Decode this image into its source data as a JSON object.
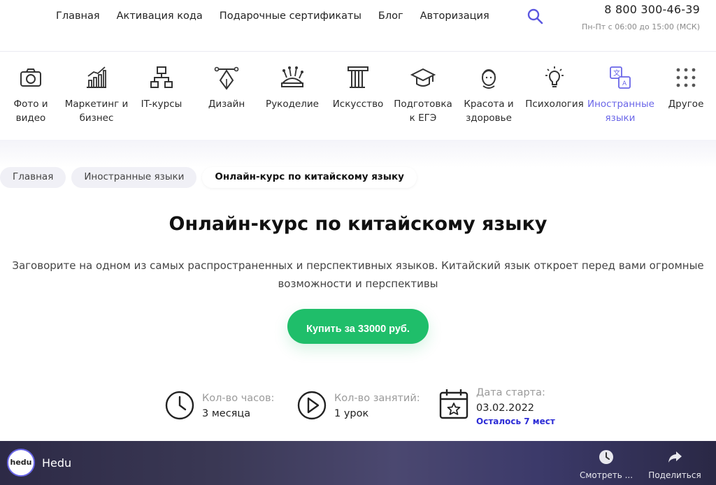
{
  "header": {
    "nav": [
      "Главная",
      "Активация кода",
      "Подарочные сертификаты",
      "Блог",
      "Авторизация"
    ],
    "phone": "8 800 300-46-39",
    "hours": "Пн-Пт с 06:00 до 15:00 (МСК)"
  },
  "categories": [
    {
      "label": "Фото и видео",
      "icon": "camera-icon"
    },
    {
      "label": "Маркетинг и бизнес",
      "icon": "chart-icon"
    },
    {
      "label": "IT-курсы",
      "icon": "network-icon"
    },
    {
      "label": "Дизайн",
      "icon": "pen-tool-icon"
    },
    {
      "label": "Рукоделие",
      "icon": "pincushion-icon"
    },
    {
      "label": "Искусство",
      "icon": "column-icon"
    },
    {
      "label": "Подготовка к ЕГЭ",
      "icon": "graduation-cap-icon"
    },
    {
      "label": "Красота и здоровье",
      "icon": "face-icon"
    },
    {
      "label": "Психология",
      "icon": "lightbulb-icon"
    },
    {
      "label": "Иностранные языки",
      "icon": "translate-icon"
    },
    {
      "label": "Другое",
      "icon": "grid-dots-icon"
    }
  ],
  "active_category_color": "#6a66e8",
  "breadcrumbs": [
    "Главная",
    "Иностранные языки",
    "Онлайн-курс по китайскому языку"
  ],
  "page": {
    "title": "Онлайн-курс по китайскому языку",
    "subtitle": "Заговорите на одном из самых распространенных и перспективных языков. Китайский язык откроет перед вами огромные возможности и перспективы",
    "buy_label": "Купить за 33000 руб.",
    "buy_color": "#1fbe6a"
  },
  "stats": {
    "hours_label": "Кол-во часов:",
    "hours_value": "3 месяца",
    "lessons_label": "Кол-во занятий:",
    "lessons_value": "1 урок",
    "start_label": "Дата старта:",
    "start_value": "03.02.2022",
    "seats_left": "Осталось 7 мест"
  },
  "video": {
    "logo": "hedu",
    "title": "Hedu",
    "watch_later": "Смотреть ...",
    "share": "Поделиться"
  }
}
